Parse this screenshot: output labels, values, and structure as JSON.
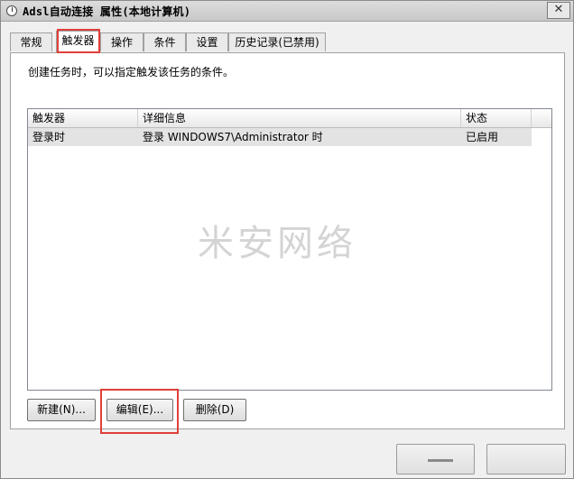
{
  "window": {
    "title": "Adsl自动连接 属性(本地计算机)",
    "close_label": "✕"
  },
  "tabs": [
    {
      "label": "常规"
    },
    {
      "label": "触发器"
    },
    {
      "label": "操作"
    },
    {
      "label": "条件"
    },
    {
      "label": "设置"
    },
    {
      "label": "历史记录(已禁用)"
    }
  ],
  "active_tab": "触发器",
  "description": "创建任务时，可以指定触发该任务的条件。",
  "table": {
    "columns": [
      "触发器",
      "详细信息",
      "状态"
    ],
    "rows": [
      {
        "trigger": "登录时",
        "details": "登录 WINDOWS7\\Administrator 时",
        "status": "已启用"
      }
    ]
  },
  "watermark": "米安网络",
  "buttons": {
    "new": "新建(N)...",
    "edit": "编辑(E)...",
    "delete": "删除(D)"
  },
  "accent_color": "#e0403a"
}
